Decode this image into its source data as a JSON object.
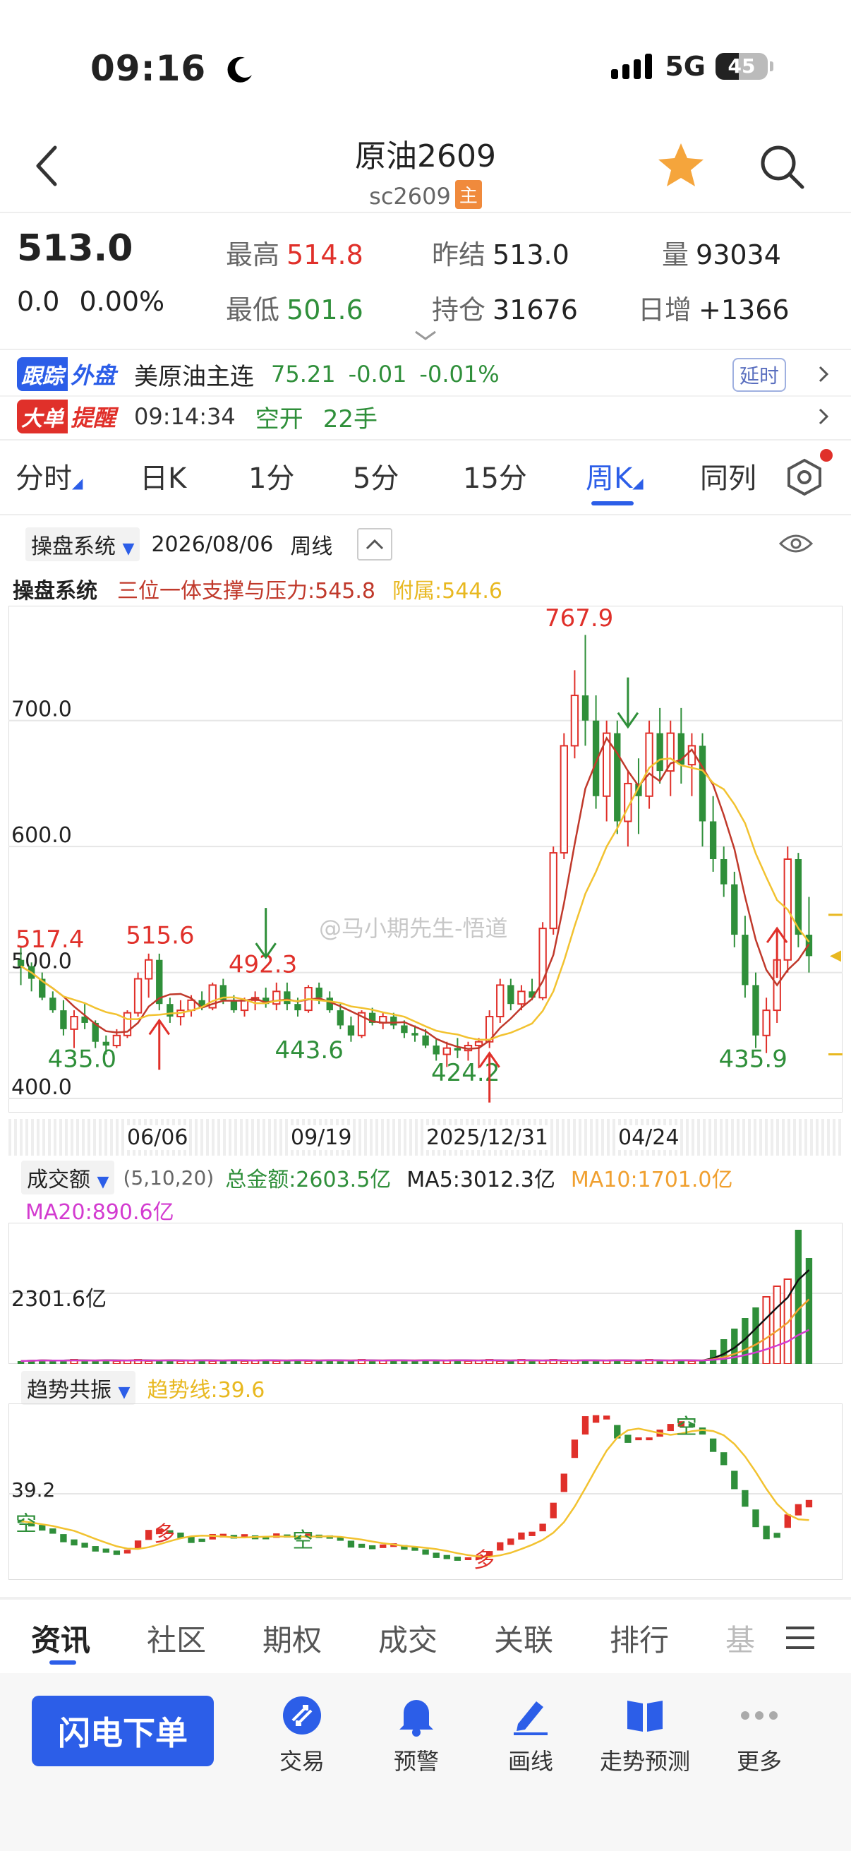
{
  "status": {
    "time": "09:16",
    "network": "5G",
    "battery": "45"
  },
  "header": {
    "title": "原油2609",
    "symbol": "sc2609",
    "main_badge": "主"
  },
  "quote": {
    "price": "513.0",
    "change": "0.0",
    "change_pct": "0.00%",
    "high_label": "最高",
    "high": "514.8",
    "low_label": "最低",
    "low": "501.6",
    "prev_settle_label": "昨结",
    "prev_settle": "513.0",
    "oi_label": "持仓",
    "oi": "31676",
    "volume_label": "量",
    "volume": "93034",
    "daily_inc_label": "日增",
    "daily_inc": "+1366"
  },
  "track": {
    "tag1": "跟踪",
    "tag2": "外盘",
    "name": "美原油主连",
    "price": "75.21",
    "chg": "-0.01",
    "pct": "-0.01%",
    "delay": "延时"
  },
  "alert": {
    "tag1": "大单",
    "tag2": "提醒",
    "time": "09:14:34",
    "action": "空开",
    "lots": "22手"
  },
  "tabs": [
    "分时",
    "日K",
    "1分",
    "5分",
    "15分",
    "周K",
    "同列"
  ],
  "active_tab": 5,
  "chart_header": {
    "system": "操盘系统",
    "date": "2026/08/06",
    "period": "周线"
  },
  "indicator": {
    "name": "操盘系统",
    "sp_label": "三位一体支撑与压力:545.8",
    "aux_label": "附属:544.6"
  },
  "price_axis": [
    "700.0",
    "600.0",
    "500.0",
    "400.0"
  ],
  "annotations": [
    "767.9",
    "517.4",
    "515.6",
    "492.3",
    "435.0",
    "443.6",
    "424.2",
    "435.9"
  ],
  "date_axis": [
    "06/06",
    "09/19",
    "2025/12/31",
    "04/24"
  ],
  "watermark": "@马小期先生-悟道",
  "volume_panel": {
    "name": "成交额",
    "params": "(5,10,20)",
    "total": "总金额:2603.5亿",
    "ma5": "MA5:3012.3亿",
    "ma10": "MA10:1701.0亿",
    "ma20": "MA20:890.6亿",
    "axis": "2301.6亿"
  },
  "trend_panel": {
    "name": "趋势共振",
    "trend": "趋势线:39.6",
    "axis": "39.2",
    "marks": [
      "空",
      "多",
      "空",
      "多",
      "空"
    ]
  },
  "bottom_tabs": [
    "资讯",
    "社区",
    "期权",
    "成交",
    "关联",
    "排行",
    "基"
  ],
  "actions": {
    "order": "闪电下单",
    "items": [
      "交易",
      "预警",
      "画线",
      "走势预测",
      "更多"
    ]
  },
  "colors": {
    "up": "#e0302a",
    "down": "#2f8f3a",
    "accent": "#2c5ee8",
    "ma_red": "#c0392b",
    "ma_yellow": "#f2c230"
  },
  "chart_data": {
    "type": "candlestick",
    "period": "weekly",
    "ylim": [
      400,
      780
    ],
    "candles": [
      [
        510,
        520,
        490,
        505
      ],
      [
        505,
        508,
        485,
        495
      ],
      [
        495,
        500,
        478,
        480
      ],
      [
        480,
        485,
        468,
        470
      ],
      [
        470,
        478,
        450,
        455
      ],
      [
        455,
        470,
        440,
        465
      ],
      [
        465,
        475,
        455,
        460
      ],
      [
        460,
        462,
        440,
        445
      ],
      [
        445,
        450,
        435,
        442
      ],
      [
        442,
        455,
        440,
        450
      ],
      [
        450,
        470,
        448,
        468
      ],
      [
        468,
        500,
        465,
        495
      ],
      [
        495,
        515,
        480,
        510
      ],
      [
        510,
        515,
        470,
        475
      ],
      [
        475,
        480,
        460,
        465
      ],
      [
        465,
        478,
        458,
        470
      ],
      [
        470,
        482,
        465,
        478
      ],
      [
        478,
        485,
        470,
        472
      ],
      [
        472,
        492,
        470,
        490
      ],
      [
        490,
        495,
        475,
        478
      ],
      [
        478,
        482,
        468,
        470
      ],
      [
        470,
        480,
        465,
        478
      ],
      [
        478,
        485,
        470,
        480
      ],
      [
        480,
        488,
        472,
        475
      ],
      [
        475,
        492,
        470,
        485
      ],
      [
        485,
        492,
        470,
        475
      ],
      [
        475,
        480,
        465,
        470
      ],
      [
        470,
        490,
        468,
        488
      ],
      [
        488,
        492,
        475,
        480
      ],
      [
        480,
        485,
        468,
        470
      ],
      [
        470,
        475,
        455,
        458
      ],
      [
        458,
        465,
        445,
        450
      ],
      [
        450,
        470,
        448,
        468
      ],
      [
        468,
        472,
        458,
        460
      ],
      [
        460,
        468,
        455,
        465
      ],
      [
        465,
        468,
        455,
        458
      ],
      [
        458,
        462,
        448,
        452
      ],
      [
        452,
        458,
        445,
        450
      ],
      [
        450,
        455,
        440,
        442
      ],
      [
        442,
        448,
        430,
        435
      ],
      [
        435,
        445,
        425,
        440
      ],
      [
        440,
        448,
        432,
        438
      ],
      [
        438,
        445,
        430,
        442
      ],
      [
        442,
        448,
        424,
        445
      ],
      [
        445,
        470,
        440,
        465
      ],
      [
        465,
        495,
        460,
        490
      ],
      [
        490,
        495,
        470,
        475
      ],
      [
        475,
        490,
        470,
        485
      ],
      [
        485,
        495,
        478,
        480
      ],
      [
        480,
        540,
        478,
        535
      ],
      [
        535,
        600,
        530,
        595
      ],
      [
        595,
        690,
        590,
        680
      ],
      [
        680,
        740,
        670,
        720
      ],
      [
        720,
        768,
        680,
        700
      ],
      [
        700,
        720,
        630,
        640
      ],
      [
        640,
        700,
        620,
        690
      ],
      [
        690,
        700,
        610,
        620
      ],
      [
        620,
        660,
        600,
        650
      ],
      [
        650,
        670,
        610,
        640
      ],
      [
        640,
        700,
        630,
        690
      ],
      [
        690,
        710,
        650,
        660
      ],
      [
        660,
        700,
        640,
        690
      ],
      [
        690,
        710,
        650,
        665
      ],
      [
        665,
        690,
        640,
        680
      ],
      [
        680,
        690,
        600,
        620
      ],
      [
        620,
        640,
        580,
        590
      ],
      [
        590,
        600,
        560,
        570
      ],
      [
        570,
        580,
        520,
        530
      ],
      [
        530,
        545,
        480,
        490
      ],
      [
        490,
        500,
        440,
        450
      ],
      [
        450,
        480,
        436,
        470
      ],
      [
        470,
        520,
        460,
        510
      ],
      [
        510,
        600,
        500,
        590
      ],
      [
        590,
        595,
        520,
        530
      ],
      [
        530,
        560,
        500,
        513
      ]
    ]
  }
}
